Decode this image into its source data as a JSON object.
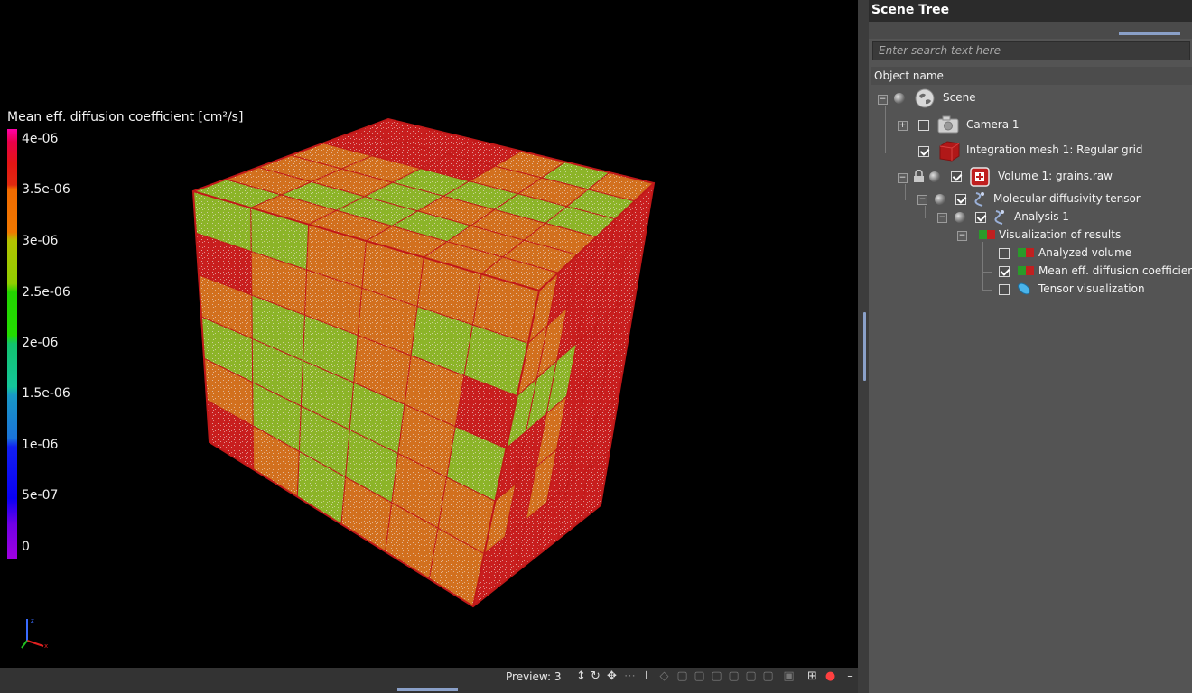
{
  "viewport": {
    "legend": {
      "title": "Mean eff. diffusion coefficient [cm²/s]",
      "ticks": [
        "4e-06",
        "3.5e-06",
        "3e-06",
        "2.5e-06",
        "2e-06",
        "1.5e-06",
        "1e-06",
        "5e-07",
        "0"
      ]
    }
  },
  "bottom_bar": {
    "preview_label": "Preview: 3"
  },
  "scene_tree": {
    "title": "Scene Tree",
    "search_placeholder": "Enter search text here",
    "column_header": "Object name",
    "items": [
      {
        "label": "Scene"
      },
      {
        "label": "Camera 1",
        "checked": false
      },
      {
        "label": "Integration mesh 1: Regular grid",
        "checked": true
      },
      {
        "label": "Volume 1: grains.raw",
        "checked": true
      },
      {
        "label": "Molecular diffusivity tensor",
        "checked": true
      },
      {
        "label": "Analysis 1",
        "checked": true
      },
      {
        "label": "Visualization of results"
      },
      {
        "label": "Analyzed volume",
        "checked": false
      },
      {
        "label": "Mean eff. diffusion coefficient",
        "checked": true
      },
      {
        "label": "Tensor visualization",
        "checked": false
      }
    ]
  },
  "colors": {
    "panel_bg": "#545454",
    "header_bg": "#2b2b2b",
    "accent_handle": "#8aa0c8",
    "cube_edge": "#c01818",
    "face_red": "#c81e1e",
    "face_orange": "#d2701e",
    "face_green": "#8cb428"
  }
}
